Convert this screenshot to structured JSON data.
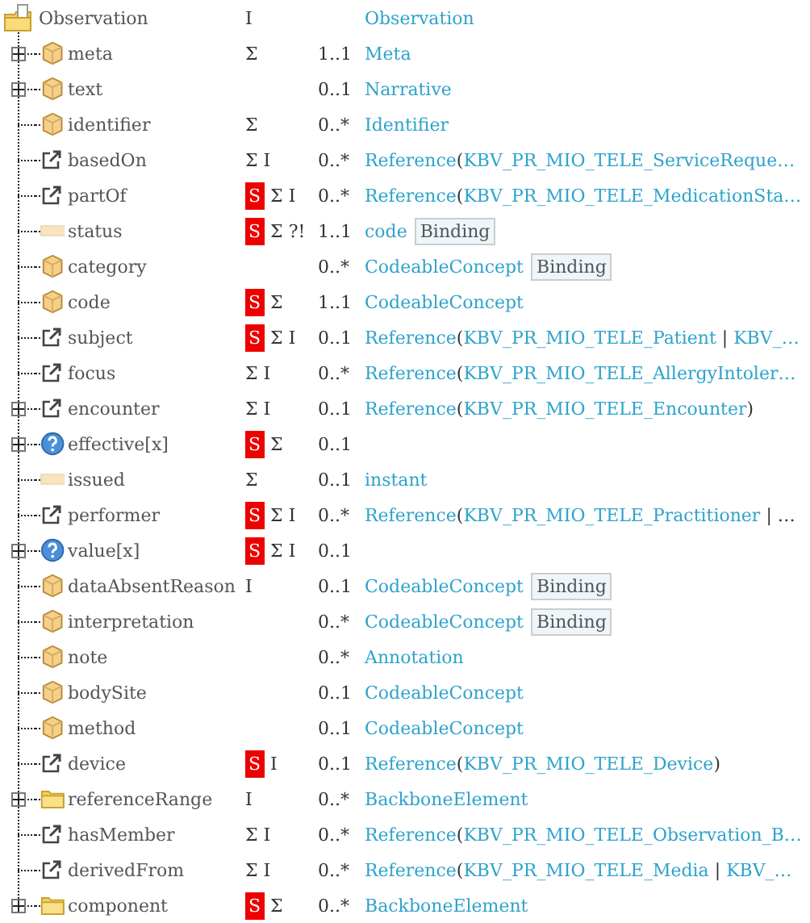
{
  "rows": [
    {
      "kind": "resource",
      "name": "Observation",
      "flags": "I",
      "type": [
        {
          "text": "Observation",
          "kind": "link"
        }
      ]
    },
    {
      "kind": "datatype",
      "collapsed": true,
      "name": "meta",
      "flags": "Σ",
      "card": "1..1",
      "type": [
        {
          "text": "Meta",
          "kind": "link"
        }
      ]
    },
    {
      "kind": "datatype",
      "collapsed": true,
      "name": "text",
      "card": "0..1",
      "type": [
        {
          "text": "Narrative",
          "kind": "link"
        }
      ]
    },
    {
      "kind": "datatype",
      "name": "identifier",
      "flags": "Σ",
      "card": "0..*",
      "type": [
        {
          "text": "Identifier",
          "kind": "link"
        }
      ]
    },
    {
      "kind": "reference",
      "name": "basedOn",
      "flags": "Σ I",
      "card": "0..*",
      "type": [
        {
          "text": "Reference",
          "kind": "link"
        },
        {
          "text": "(",
          "kind": "plain"
        },
        {
          "text": "KBV_PR_MIO_TELE_ServiceReque…",
          "kind": "link"
        }
      ]
    },
    {
      "kind": "reference",
      "name": "partOf",
      "badge": "S",
      "flags": "Σ I",
      "card": "0..*",
      "type": [
        {
          "text": "Reference",
          "kind": "link"
        },
        {
          "text": "(",
          "kind": "plain"
        },
        {
          "text": "KBV_PR_MIO_TELE_MedicationSta…",
          "kind": "link"
        }
      ]
    },
    {
      "kind": "primitive",
      "name": "status",
      "badge": "S",
      "flags": "Σ ?!",
      "card": "1..1",
      "type": [
        {
          "text": "code",
          "kind": "link"
        }
      ],
      "binding": "Binding"
    },
    {
      "kind": "datatype",
      "name": "category",
      "card": "0..*",
      "type": [
        {
          "text": "CodeableConcept",
          "kind": "link"
        }
      ],
      "binding": "Binding"
    },
    {
      "kind": "datatype",
      "name": "code",
      "badge": "S",
      "flags": "Σ",
      "card": "1..1",
      "type": [
        {
          "text": "CodeableConcept",
          "kind": "link"
        }
      ]
    },
    {
      "kind": "reference",
      "name": "subject",
      "badge": "S",
      "flags": "Σ I",
      "card": "0..1",
      "type": [
        {
          "text": "Reference",
          "kind": "link"
        },
        {
          "text": "(",
          "kind": "plain"
        },
        {
          "text": "KBV_PR_MIO_TELE_Patient",
          "kind": "link"
        },
        {
          "text": " | ",
          "kind": "plain"
        },
        {
          "text": "KBV_…",
          "kind": "link"
        }
      ]
    },
    {
      "kind": "reference",
      "name": "focus",
      "flags": "Σ I",
      "card": "0..*",
      "type": [
        {
          "text": "Reference",
          "kind": "link"
        },
        {
          "text": "(",
          "kind": "plain"
        },
        {
          "text": "KBV_PR_MIO_TELE_AllergyIntoler…",
          "kind": "link"
        }
      ]
    },
    {
      "kind": "reference",
      "collapsed": true,
      "name": "encounter",
      "flags": "Σ I",
      "card": "0..1",
      "type": [
        {
          "text": "Reference",
          "kind": "link"
        },
        {
          "text": "(",
          "kind": "plain"
        },
        {
          "text": "KBV_PR_MIO_TELE_Encounter",
          "kind": "link"
        },
        {
          "text": ")",
          "kind": "plain"
        }
      ]
    },
    {
      "kind": "choice",
      "collapsed": true,
      "name": "effective[x]",
      "badge": "S",
      "flags": "Σ",
      "card": "0..1"
    },
    {
      "kind": "primitive",
      "name": "issued",
      "flags": "Σ",
      "card": "0..1",
      "type": [
        {
          "text": "instant",
          "kind": "link"
        }
      ]
    },
    {
      "kind": "reference",
      "name": "performer",
      "badge": "S",
      "flags": "Σ I",
      "card": "0..*",
      "type": [
        {
          "text": "Reference",
          "kind": "link"
        },
        {
          "text": "(",
          "kind": "plain"
        },
        {
          "text": "KBV_PR_MIO_TELE_Practitioner",
          "kind": "link"
        },
        {
          "text": " | …",
          "kind": "plain"
        }
      ]
    },
    {
      "kind": "choice",
      "collapsed": true,
      "name": "value[x]",
      "badge": "S",
      "flags": "Σ I",
      "card": "0..1"
    },
    {
      "kind": "datatype",
      "name": "dataAbsentReason",
      "flags": "I",
      "card": "0..1",
      "type": [
        {
          "text": "CodeableConcept",
          "kind": "link"
        }
      ],
      "binding": "Binding"
    },
    {
      "kind": "datatype",
      "name": "interpretation",
      "card": "0..*",
      "type": [
        {
          "text": "CodeableConcept",
          "kind": "link"
        }
      ],
      "binding": "Binding"
    },
    {
      "kind": "datatype",
      "name": "note",
      "card": "0..*",
      "type": [
        {
          "text": "Annotation",
          "kind": "link"
        }
      ]
    },
    {
      "kind": "datatype",
      "name": "bodySite",
      "card": "0..1",
      "type": [
        {
          "text": "CodeableConcept",
          "kind": "link"
        }
      ]
    },
    {
      "kind": "datatype",
      "name": "method",
      "card": "0..1",
      "type": [
        {
          "text": "CodeableConcept",
          "kind": "link"
        }
      ]
    },
    {
      "kind": "reference",
      "name": "device",
      "badge": "S",
      "flags": "I",
      "card": "0..1",
      "type": [
        {
          "text": "Reference",
          "kind": "link"
        },
        {
          "text": "(",
          "kind": "plain"
        },
        {
          "text": "KBV_PR_MIO_TELE_Device",
          "kind": "link"
        },
        {
          "text": ")",
          "kind": "plain"
        }
      ]
    },
    {
      "kind": "backbone",
      "collapsed": true,
      "name": "referenceRange",
      "flags": "I",
      "card": "0..*",
      "type": [
        {
          "text": "BackboneElement",
          "kind": "link"
        }
      ]
    },
    {
      "kind": "reference",
      "name": "hasMember",
      "flags": "Σ I",
      "card": "0..*",
      "type": [
        {
          "text": "Reference",
          "kind": "link"
        },
        {
          "text": "(",
          "kind": "plain"
        },
        {
          "text": "KBV_PR_MIO_TELE_Observation_B…",
          "kind": "link"
        }
      ]
    },
    {
      "kind": "reference",
      "name": "derivedFrom",
      "flags": "Σ I",
      "card": "0..*",
      "type": [
        {
          "text": "Reference",
          "kind": "link"
        },
        {
          "text": "(",
          "kind": "plain"
        },
        {
          "text": "KBV_PR_MIO_TELE_Media",
          "kind": "link"
        },
        {
          "text": " | ",
          "kind": "plain"
        },
        {
          "text": "KBV_…",
          "kind": "link"
        }
      ]
    },
    {
      "kind": "backbone",
      "collapsed": true,
      "name": "component",
      "badge": "S",
      "flags": "Σ",
      "card": "0..*",
      "type": [
        {
          "text": "BackboneElement",
          "kind": "link"
        }
      ]
    }
  ]
}
